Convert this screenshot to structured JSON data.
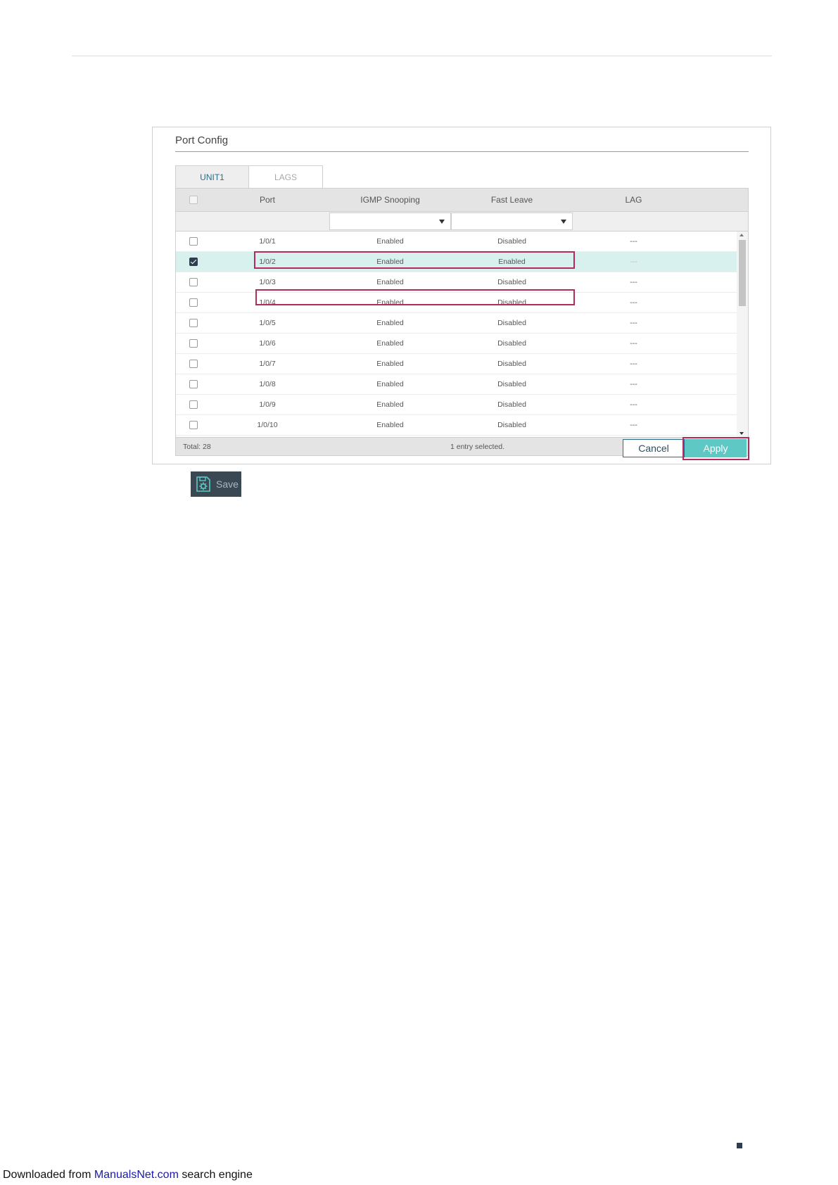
{
  "panel": {
    "title": "Port Config",
    "tabs": [
      {
        "label": "UNIT1",
        "active": true
      },
      {
        "label": "LAGS",
        "active": false
      }
    ]
  },
  "table": {
    "columns": [
      "Port",
      "IGMP Snooping",
      "Fast Leave",
      "LAG"
    ],
    "rows": [
      {
        "checked": false,
        "port": "1/0/1",
        "igmp": "Enabled",
        "fast_leave": "Disabled",
        "lag": "---"
      },
      {
        "checked": true,
        "port": "1/0/2",
        "igmp": "Enabled",
        "fast_leave": "Enabled",
        "lag": "---"
      },
      {
        "checked": false,
        "port": "1/0/3",
        "igmp": "Enabled",
        "fast_leave": "Disabled",
        "lag": "---"
      },
      {
        "checked": false,
        "port": "1/0/4",
        "igmp": "Enabled",
        "fast_leave": "Disabled",
        "lag": "---"
      },
      {
        "checked": false,
        "port": "1/0/5",
        "igmp": "Enabled",
        "fast_leave": "Disabled",
        "lag": "---"
      },
      {
        "checked": false,
        "port": "1/0/6",
        "igmp": "Enabled",
        "fast_leave": "Disabled",
        "lag": "---"
      },
      {
        "checked": false,
        "port": "1/0/7",
        "igmp": "Enabled",
        "fast_leave": "Disabled",
        "lag": "---"
      },
      {
        "checked": false,
        "port": "1/0/8",
        "igmp": "Enabled",
        "fast_leave": "Disabled",
        "lag": "---"
      },
      {
        "checked": false,
        "port": "1/0/9",
        "igmp": "Enabled",
        "fast_leave": "Disabled",
        "lag": "---"
      },
      {
        "checked": false,
        "port": "1/0/10",
        "igmp": "Enabled",
        "fast_leave": "Disabled",
        "lag": "---"
      }
    ],
    "footer": {
      "total": "Total: 28",
      "selected": "1 entry selected."
    }
  },
  "buttons": {
    "cancel": "Cancel",
    "apply": "Apply",
    "save": "Save"
  },
  "page_footer": {
    "prefix": "Downloaded from ",
    "link": "ManualsNet.com",
    "suffix": " search engine"
  },
  "colors": {
    "accent": "#5ec8c4",
    "highlight": "#b32b5c",
    "selected_row": "#d9f1ee"
  }
}
